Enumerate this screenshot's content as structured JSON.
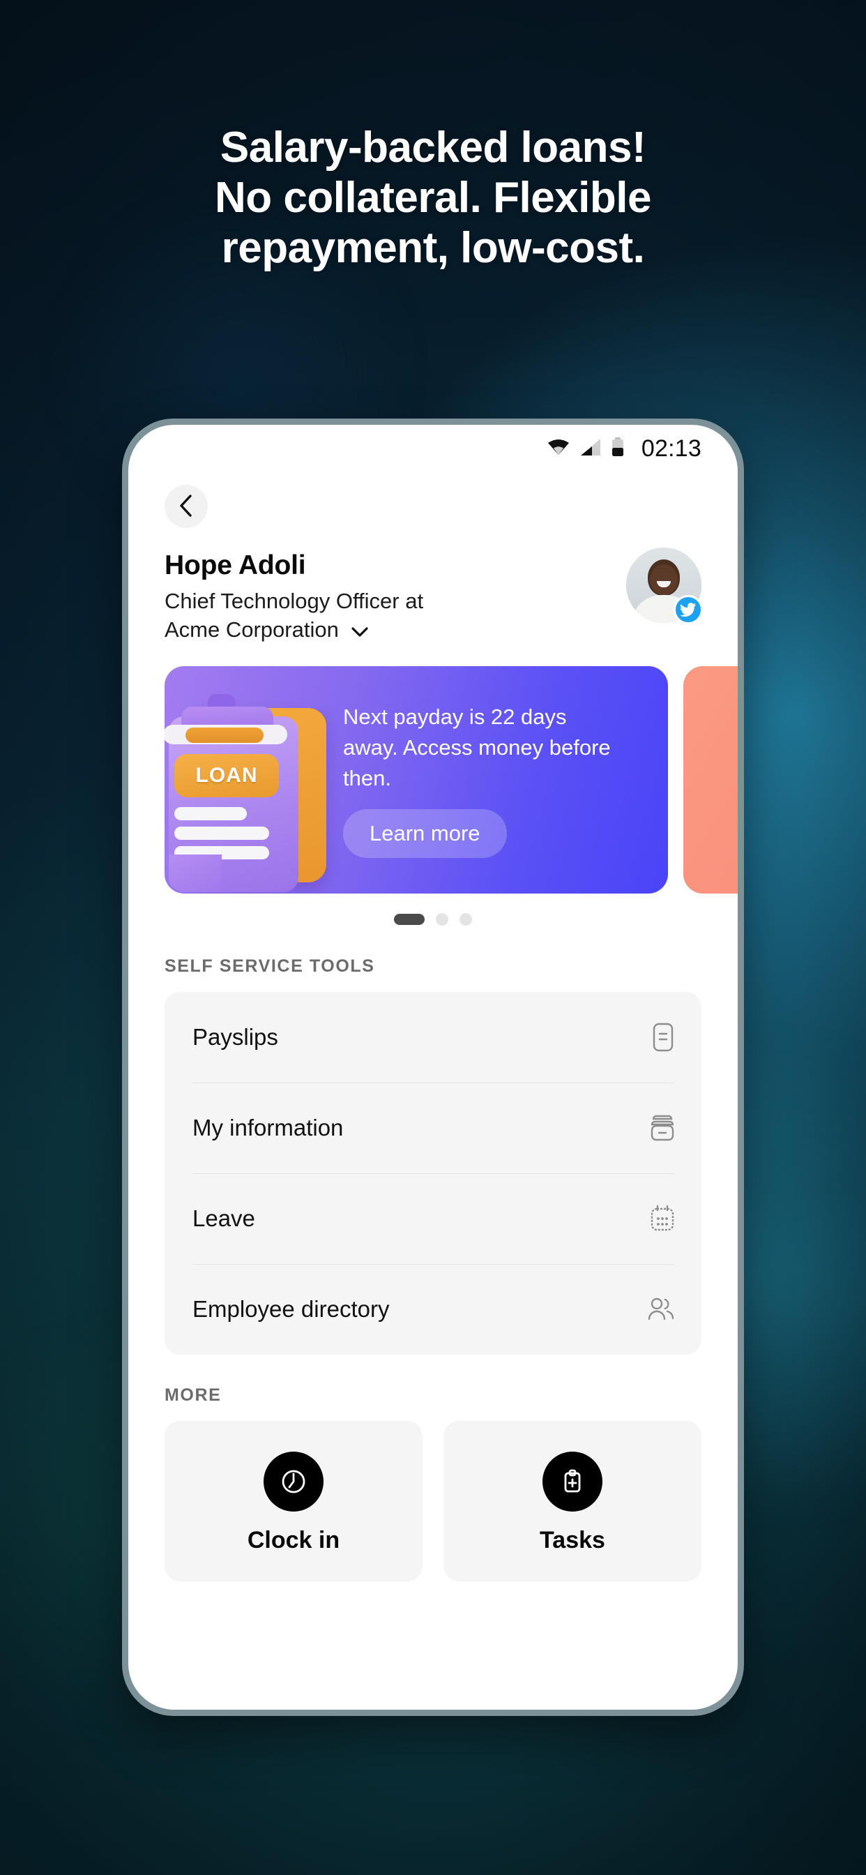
{
  "promo": {
    "headline_lines": [
      "Salary-backed loans!",
      "No collateral. Flexible",
      "repayment, low-cost."
    ]
  },
  "statusbar": {
    "time": "02:13",
    "icons": [
      "wifi-icon",
      "cellular-signal-icon",
      "battery-icon"
    ]
  },
  "nav": {
    "back_label": "‹"
  },
  "profile": {
    "name": "Hope Adoli",
    "role_line1": "Chief Technology Officer at",
    "role_line2": "Acme Corporation",
    "chevron": "⌄",
    "badge": "twitter-badge"
  },
  "carousel": {
    "cards": [
      {
        "message": "Next payday is 22 days away. Access  money before then.",
        "cta": "Learn more",
        "illustration_label": "LOAN",
        "accent": "#5a50f5"
      },
      {
        "message": "",
        "cta": "",
        "illustration_label": "",
        "accent": "#f8897a"
      }
    ],
    "dots": [
      {
        "active": true
      },
      {
        "active": false
      },
      {
        "active": false
      }
    ]
  },
  "self_service": {
    "title": "SELF SERVICE TOOLS",
    "items": [
      {
        "label": "Payslips",
        "icon": "payslip-document-icon"
      },
      {
        "label": "My information",
        "icon": "archive-box-icon"
      },
      {
        "label": "Leave",
        "icon": "calendar-icon"
      },
      {
        "label": "Employee directory",
        "icon": "people-icon"
      }
    ]
  },
  "more": {
    "title": "MORE",
    "items": [
      {
        "label": "Clock in",
        "icon": "clock-icon"
      },
      {
        "label": "Tasks",
        "icon": "clipboard-plus-icon"
      }
    ]
  }
}
